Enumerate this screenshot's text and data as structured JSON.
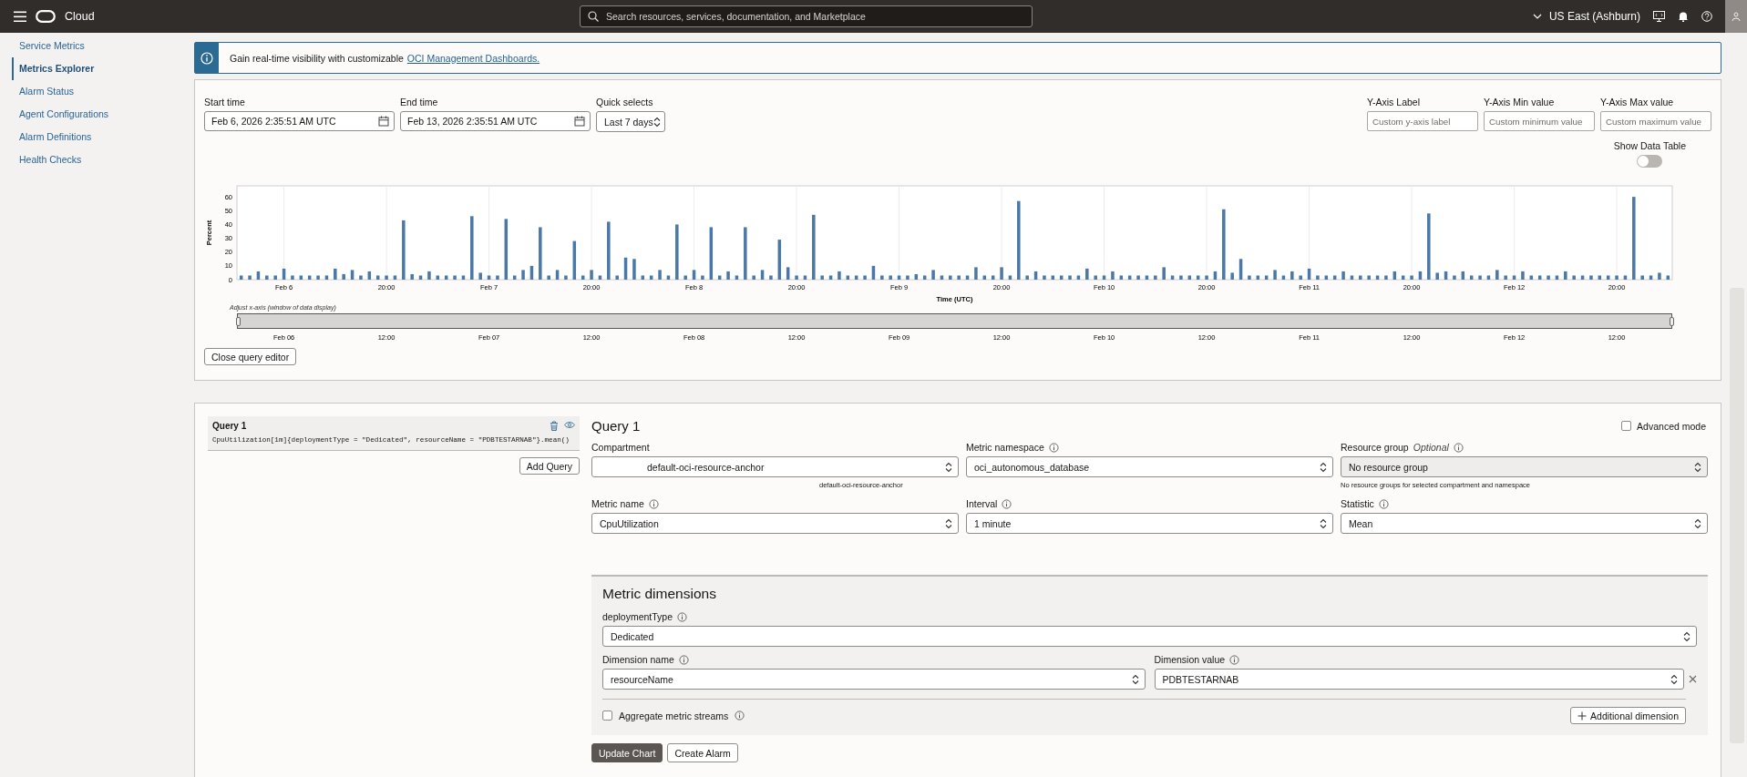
{
  "header": {
    "brand": "Cloud",
    "search_placeholder": "Search resources, services, documentation, and Marketplace",
    "region": "US East (Ashburn)"
  },
  "sidebar": {
    "items": [
      {
        "label": "Service Metrics",
        "selected": false
      },
      {
        "label": "Metrics Explorer",
        "selected": true
      },
      {
        "label": "Alarm Status",
        "selected": false
      },
      {
        "label": "Agent Configurations",
        "selected": false
      },
      {
        "label": "Alarm Definitions",
        "selected": false
      },
      {
        "label": "Health Checks",
        "selected": false
      }
    ]
  },
  "banner": {
    "text": "Gain real-time visibility with customizable",
    "link": "OCI Management Dashboards."
  },
  "time_controls": {
    "start_label": "Start time",
    "start_value": "Feb 6, 2026 2:35:51 AM UTC",
    "end_label": "End time",
    "end_value": "Feb 13, 2026 2:35:51 AM UTC",
    "quick_label": "Quick selects",
    "quick_value": "Last 7 days"
  },
  "axis_fields": [
    {
      "label": "Y-Axis Label",
      "placeholder": "Custom y-axis label"
    },
    {
      "label": "Y-Axis Min value",
      "placeholder": "Custom minimum value"
    },
    {
      "label": "Y-Axis Max value",
      "placeholder": "Custom maximum value"
    }
  ],
  "data_table_toggle": {
    "label": "Show Data Table",
    "on": false
  },
  "chart_data": {
    "type": "bar",
    "xlabel": "Time (UTC)",
    "ylabel": "Percent",
    "ylim": [
      0,
      68
    ],
    "yticks": [
      0,
      10,
      20,
      30,
      40,
      50,
      60
    ],
    "categories": [
      null,
      null,
      null,
      null,
      null,
      "Feb 6",
      null,
      null,
      null,
      null,
      null,
      null,
      null,
      null,
      null,
      null,
      null,
      "20:00",
      null,
      null,
      null,
      null,
      null,
      null,
      null,
      null,
      null,
      null,
      null,
      "Feb 7",
      null,
      null,
      null,
      null,
      null,
      null,
      null,
      null,
      null,
      null,
      null,
      "20:00",
      null,
      null,
      null,
      null,
      null,
      null,
      null,
      null,
      null,
      null,
      null,
      "Feb 8",
      null,
      null,
      null,
      null,
      null,
      null,
      null,
      null,
      null,
      null,
      null,
      "20:00",
      null,
      null,
      null,
      null,
      null,
      null,
      null,
      null,
      null,
      null,
      null,
      "Feb 9",
      null,
      null,
      null,
      null,
      null,
      null,
      null,
      null,
      null,
      null,
      null,
      "20:00",
      null,
      null,
      null,
      null,
      null,
      null,
      null,
      null,
      null,
      null,
      null,
      "Feb 10",
      null,
      null,
      null,
      null,
      null,
      null,
      null,
      null,
      null,
      null,
      null,
      "20:00",
      null,
      null,
      null,
      null,
      null,
      null,
      null,
      null,
      null,
      null,
      null,
      "Feb 11",
      null,
      null,
      null,
      null,
      null,
      null,
      null,
      null,
      null,
      null,
      null,
      "20:00",
      null,
      null,
      null,
      null,
      null,
      null,
      null,
      null,
      null,
      null,
      null,
      "Feb 12",
      null,
      null,
      null,
      null,
      null,
      null,
      null,
      null,
      null,
      null,
      null,
      "20:00",
      null,
      null,
      null,
      null,
      null,
      null
    ],
    "series": [
      {
        "color": "#4a78a8",
        "values": [
          3,
          3,
          6,
          3,
          3,
          8,
          3,
          3,
          3,
          3,
          3,
          8,
          4,
          7,
          3,
          6,
          3,
          3,
          3,
          43,
          4,
          3,
          6,
          3,
          3,
          3,
          3,
          46,
          5,
          3,
          3,
          44,
          3,
          7,
          10,
          38,
          3,
          7,
          3,
          28,
          3,
          7,
          3,
          42,
          3,
          16,
          15,
          3,
          3,
          7,
          3,
          40,
          3,
          7,
          3,
          38,
          3,
          6,
          3,
          38,
          3,
          7,
          3,
          29,
          9,
          3,
          3,
          47,
          3,
          3,
          6,
          3,
          3,
          3,
          10,
          3,
          3,
          3,
          3,
          4,
          3,
          7,
          3,
          3,
          3,
          3,
          9,
          3,
          3,
          9,
          3,
          57,
          3,
          6,
          3,
          3,
          3,
          3,
          3,
          8,
          3,
          3,
          6,
          3,
          3,
          3,
          3,
          3,
          9,
          3,
          3,
          3,
          3,
          3,
          6,
          51,
          5,
          15,
          3,
          3,
          3,
          7,
          3,
          6,
          3,
          8,
          3,
          3,
          3,
          6,
          3,
          3,
          3,
          3,
          3,
          6,
          3,
          3,
          6,
          48,
          5,
          6,
          3,
          6,
          3,
          3,
          3,
          7,
          3,
          3,
          6,
          3,
          3,
          3,
          3,
          6,
          3,
          3,
          3,
          3,
          3,
          3,
          3,
          60,
          3,
          3,
          5,
          3
        ]
      }
    ]
  },
  "range": {
    "caption": "Adjust x-axis (window of data display)",
    "handles": [
      {
        "level": 0
      },
      {
        "level": 1
      }
    ],
    "ticks": [
      "Feb 06",
      "12:00",
      "Feb 07",
      "12:00",
      "Feb 08",
      "12:00",
      "Feb 09",
      "12:00",
      "Feb 10",
      "12:00",
      "Feb 11",
      "12:00",
      "Feb 12",
      "12:00"
    ]
  },
  "close_button": "Close query editor",
  "queries": [
    {
      "title": "Query 1",
      "expression": "CpuUtilization[1m]{deploymentType = \"Dedicated\", resourceName = \"PDBTESTARNAB\"}.mean()",
      "selected": true
    }
  ],
  "add_query": "Add Query",
  "editor": {
    "title": "Query 1",
    "advanced_mode": {
      "label": "Advanced mode",
      "checked": false
    },
    "fields": [
      {
        "label": "Compartment",
        "info": false,
        "value": "default-oci-resource-anchor",
        "hint": "default-oci-resource-anchor",
        "disabled": false
      },
      {
        "label": "Metric namespace",
        "info": true,
        "value": "oci_autonomous_database",
        "disabled": false
      },
      {
        "label": "Resource group",
        "optional": "Optional",
        "info": true,
        "value": "No resource group",
        "hint": "No resource groups for selected compartment and namespace",
        "disabled": true
      },
      {
        "label": "Metric name",
        "info": true,
        "value": "CpuUtilization",
        "disabled": false
      },
      {
        "label": "Interval",
        "info": true,
        "value": "1 minute",
        "disabled": false
      },
      {
        "label": "Statistic",
        "info": true,
        "value": "Mean",
        "disabled": false
      }
    ]
  },
  "dimensions": {
    "title": "Metric dimensions",
    "fixed": {
      "label": "deploymentType",
      "value": "Dedicated"
    },
    "name": {
      "label": "Dimension name",
      "value": "resourceName"
    },
    "value": {
      "label": "Dimension value",
      "value": "PDBTESTARNAB"
    },
    "aggregate": {
      "label": "Aggregate metric streams",
      "checked": false
    },
    "add_button": "Additional dimension"
  },
  "actions": [
    {
      "label": "Update Chart",
      "kind": "primary"
    },
    {
      "label": "Create Alarm",
      "kind": "secondary"
    }
  ]
}
